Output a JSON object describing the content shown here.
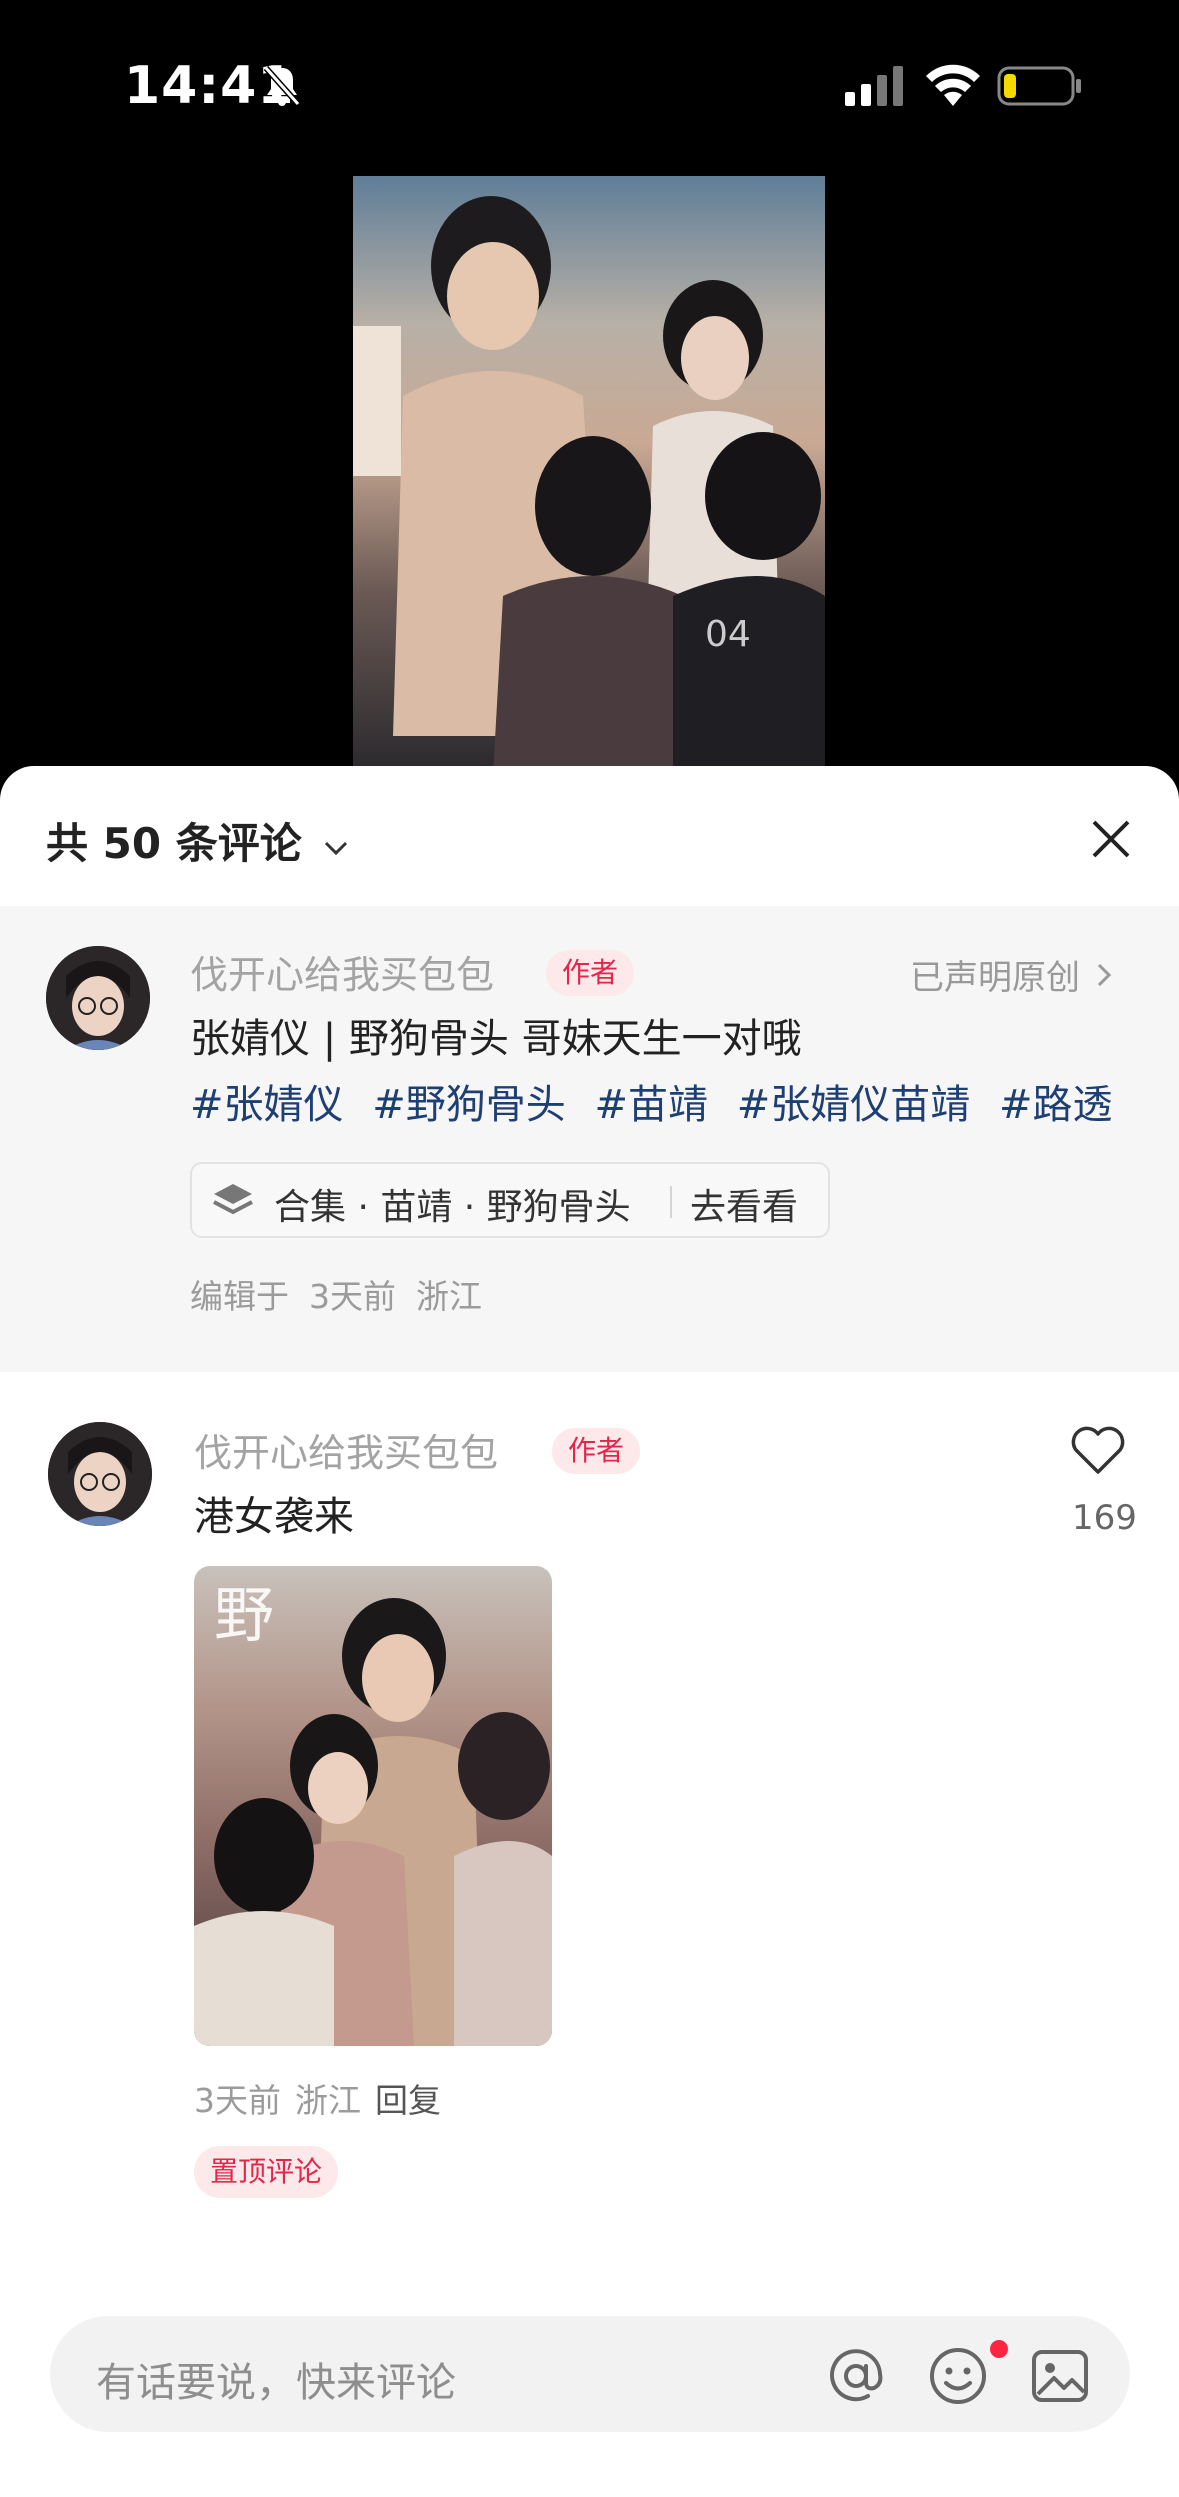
{
  "status_bar": {
    "time": "14:41"
  },
  "comments_header": {
    "count_label": "共 50 条评论"
  },
  "post": {
    "author": "伐开心给我买包包",
    "author_badge": "作者",
    "original_label": "已声明原创",
    "title": "张婧仪 | 野狗骨头 哥妹天生一对哦",
    "tags": [
      "#张婧仪",
      "#野狗骨头",
      "#苗靖",
      "#张婧仪苗靖",
      "#路透"
    ],
    "collection": {
      "label": "合集 · 苗靖 · 野狗骨头",
      "action": "去看看"
    },
    "edit_meta": {
      "prefix": "编辑于",
      "time": "3天前",
      "location": "浙江"
    }
  },
  "comment": {
    "author": "伐开心给我买包包",
    "author_badge": "作者",
    "text": "港女袭来",
    "time": "3天前",
    "location": "浙江",
    "reply_label": "回复",
    "pinned_label": "置顶评论",
    "like_count": "169"
  },
  "input_bar": {
    "placeholder": "有话要说，快来评论"
  },
  "colors": {
    "accent": "#ff2442",
    "tag": "#1e3f73",
    "badge_bg": "#fde8ea"
  }
}
